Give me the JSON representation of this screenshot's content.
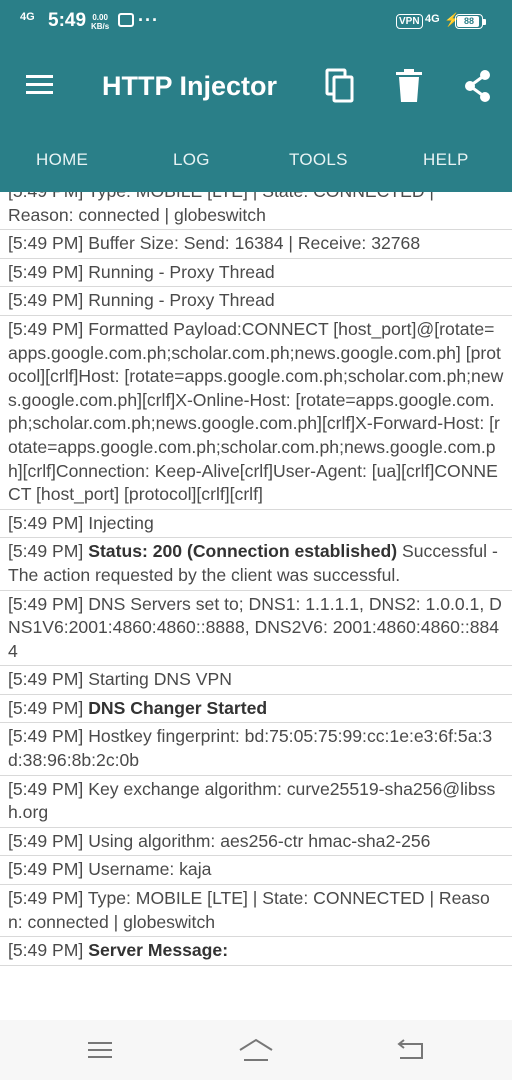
{
  "status_bar": {
    "network_left": "4G",
    "time": "5:49",
    "speed_value": "0.00",
    "speed_unit": "KB/s",
    "more": "···",
    "vpn": "VPN",
    "network_right": "4G",
    "battery": "88"
  },
  "app_bar": {
    "title": "HTTP Injector"
  },
  "tabs": [
    {
      "label": "HOME"
    },
    {
      "label": "LOG"
    },
    {
      "label": "TOOLS"
    },
    {
      "label": "HELP"
    }
  ],
  "log": {
    "partial_line_top": "[5:49 PM] Type: MOBILE [LTE] | State: CONNECTED |",
    "partial_line_bottom": "Reason: connected | globeswitch",
    "entries": [
      {
        "time": "[5:49 PM]",
        "text": "Buffer Size: Send: 16384 | Receive: 32768"
      },
      {
        "time": "[5:49 PM]",
        "text": "Running - Proxy Thread"
      },
      {
        "time": "[5:49 PM]",
        "text": "Running - Proxy Thread"
      },
      {
        "time": "[5:49 PM]",
        "text": "Formatted Payload:CONNECT [host_port]@[rotate=apps.google.com.ph;scholar.com.ph;news.google.com.ph] [protocol][crlf]Host: [rotate=apps.google.com.ph;scholar.com.ph;news.google.com.ph][crlf]X-Online-Host: [rotate=apps.google.com.ph;scholar.com.ph;news.google.com.ph][crlf]X-Forward-Host: [rotate=apps.google.com.ph;scholar.com.ph;news.google.com.ph][crlf]Connection: Keep-Alive[crlf]User-Agent: [ua][crlf]CONNECT [host_port] [protocol][crlf][crlf]"
      },
      {
        "time": "[5:49 PM]",
        "text": "Injecting"
      },
      {
        "time": "[5:49 PM]",
        "bold": "Status: 200 (Connection established)",
        "text": "Successful - The action requested by the client was successful."
      },
      {
        "time": "[5:49 PM]",
        "text": "DNS Servers set to; DNS1: 1.1.1.1, DNS2: 1.0.0.1, DNS1V6:2001:4860:4860::8888, DNS2V6: 2001:4860:4860::8844"
      },
      {
        "time": "[5:49 PM]",
        "text": "Starting DNS VPN"
      },
      {
        "time": "[5:49 PM]",
        "bold": "DNS Changer Started"
      },
      {
        "time": "[5:49 PM]",
        "text": "Hostkey fingerprint: bd:75:05:75:99:cc:1e:e3:6f:5a:3d:38:96:8b:2c:0b"
      },
      {
        "time": "[5:49 PM]",
        "text": "Key exchange algorithm: curve25519-sha256@libssh.org"
      },
      {
        "time": "[5:49 PM]",
        "text": "Using algorithm: aes256-ctr hmac-sha2-256"
      },
      {
        "time": "[5:49 PM]",
        "text": "Username: kaja"
      },
      {
        "time": "[5:49 PM]",
        "text": "Type: MOBILE [LTE] | State: CONNECTED | Reason: connected | globeswitch"
      },
      {
        "time": "[5:49 PM]",
        "bold": "Server Message:"
      }
    ]
  },
  "icons": {
    "menu": "hamburger-menu-icon",
    "copy": "copy-icon",
    "delete": "trash-icon",
    "share": "share-icon",
    "nav_menu": "recents-icon",
    "nav_home": "home-icon",
    "nav_back": "back-icon"
  },
  "colors": {
    "primary": "#2a7f88",
    "log_text": "#4a4a4a",
    "divider": "#d9d9d9"
  }
}
